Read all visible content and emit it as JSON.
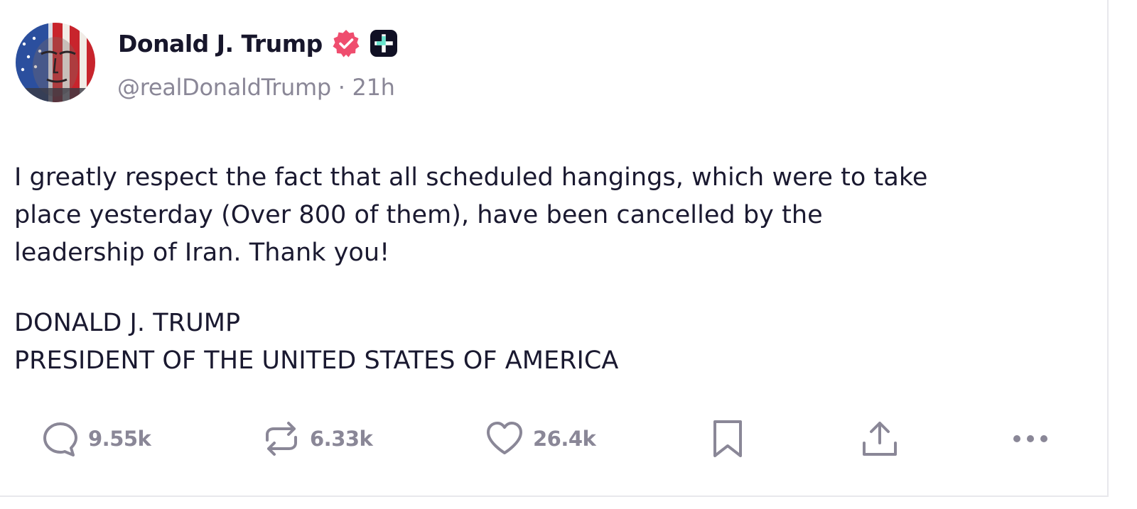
{
  "author": {
    "display_name": "Donald J. Trump",
    "handle": "@realDonaldTrump",
    "separator": "·",
    "time_ago": "21h",
    "verified_icon": "verified-badge-icon",
    "verified_color": "#ef4d6e",
    "plus_icon": "plus-badge-icon"
  },
  "post": {
    "body": "I greatly respect the fact that all scheduled hangings, which were to take\nplace yesterday (Over 800 of them), have been cancelled by the\nleadership of Iran. Thank you!",
    "signature_line1": "DONALD J. TRUMP",
    "signature_line2": "PRESIDENT OF THE UNITED STATES OF AMERICA"
  },
  "actions": {
    "replies": {
      "icon": "reply-icon",
      "count": "9.55k"
    },
    "reposts": {
      "icon": "repost-icon",
      "count": "6.33k"
    },
    "likes": {
      "icon": "heart-icon",
      "count": "26.4k"
    },
    "bookmark": {
      "icon": "bookmark-icon"
    },
    "share": {
      "icon": "share-icon"
    },
    "more": {
      "icon": "more-icon"
    }
  },
  "colors": {
    "text": "#1a1930",
    "muted": "#8a8797",
    "accent": "#ef4d6e"
  }
}
